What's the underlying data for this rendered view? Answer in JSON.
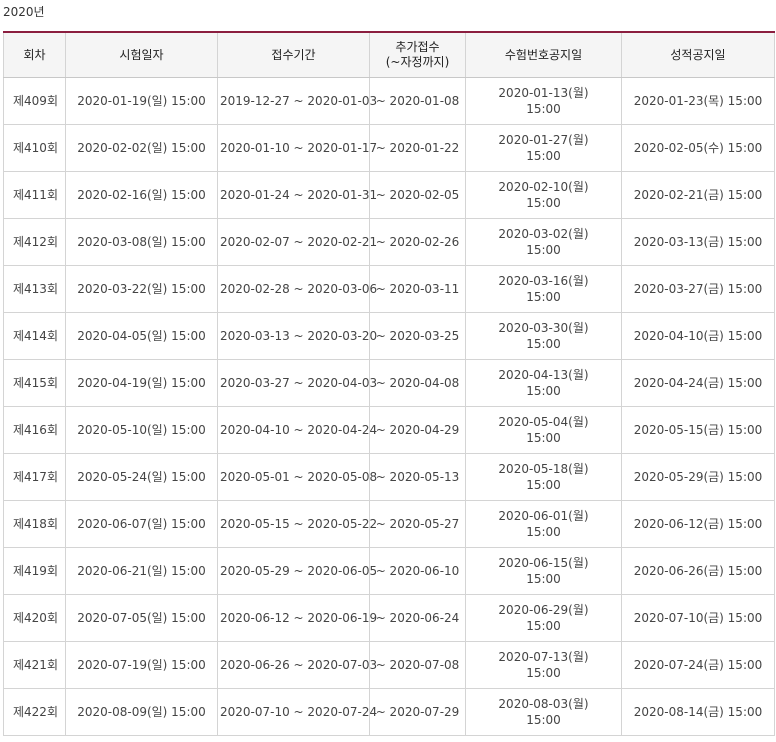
{
  "year_label": "2020년",
  "table": {
    "headers": {
      "round": "회차",
      "exam_date": "시험일자",
      "registration_period": "접수기간",
      "additional_registration_line1": "추가접수",
      "additional_registration_line2": "(~자정까지)",
      "ticket_notice": "수험번호공지일",
      "score_notice": "성적공지일"
    },
    "rows": [
      {
        "round": "제409회",
        "exam_date": "2020-01-19(일) 15:00",
        "registration_period": "2019-12-27 ~ 2020-01-03",
        "additional_registration": "~ 2020-01-08",
        "ticket_notice_date": "2020-01-13(월)",
        "ticket_notice_time": "15:00",
        "score_notice": "2020-01-23(목) 15:00"
      },
      {
        "round": "제410회",
        "exam_date": "2020-02-02(일) 15:00",
        "registration_period": "2020-01-10 ~ 2020-01-17",
        "additional_registration": "~ 2020-01-22",
        "ticket_notice_date": "2020-01-27(월)",
        "ticket_notice_time": "15:00",
        "score_notice": "2020-02-05(수) 15:00"
      },
      {
        "round": "제411회",
        "exam_date": "2020-02-16(일) 15:00",
        "registration_period": "2020-01-24 ~ 2020-01-31",
        "additional_registration": "~ 2020-02-05",
        "ticket_notice_date": "2020-02-10(월)",
        "ticket_notice_time": "15:00",
        "score_notice": "2020-02-21(금) 15:00"
      },
      {
        "round": "제412회",
        "exam_date": "2020-03-08(일) 15:00",
        "registration_period": "2020-02-07 ~ 2020-02-21",
        "additional_registration": "~ 2020-02-26",
        "ticket_notice_date": "2020-03-02(월)",
        "ticket_notice_time": "15:00",
        "score_notice": "2020-03-13(금) 15:00"
      },
      {
        "round": "제413회",
        "exam_date": "2020-03-22(일) 15:00",
        "registration_period": "2020-02-28 ~ 2020-03-06",
        "additional_registration": "~ 2020-03-11",
        "ticket_notice_date": "2020-03-16(월)",
        "ticket_notice_time": "15:00",
        "score_notice": "2020-03-27(금) 15:00"
      },
      {
        "round": "제414회",
        "exam_date": "2020-04-05(일) 15:00",
        "registration_period": "2020-03-13 ~ 2020-03-20",
        "additional_registration": "~ 2020-03-25",
        "ticket_notice_date": "2020-03-30(월)",
        "ticket_notice_time": "15:00",
        "score_notice": "2020-04-10(금) 15:00"
      },
      {
        "round": "제415회",
        "exam_date": "2020-04-19(일) 15:00",
        "registration_period": "2020-03-27 ~ 2020-04-03",
        "additional_registration": "~ 2020-04-08",
        "ticket_notice_date": "2020-04-13(월)",
        "ticket_notice_time": "15:00",
        "score_notice": "2020-04-24(금) 15:00"
      },
      {
        "round": "제416회",
        "exam_date": "2020-05-10(일) 15:00",
        "registration_period": "2020-04-10 ~ 2020-04-24",
        "additional_registration": "~ 2020-04-29",
        "ticket_notice_date": "2020-05-04(월)",
        "ticket_notice_time": "15:00",
        "score_notice": "2020-05-15(금) 15:00"
      },
      {
        "round": "제417회",
        "exam_date": "2020-05-24(일) 15:00",
        "registration_period": "2020-05-01 ~ 2020-05-08",
        "additional_registration": "~ 2020-05-13",
        "ticket_notice_date": "2020-05-18(월)",
        "ticket_notice_time": "15:00",
        "score_notice": "2020-05-29(금) 15:00"
      },
      {
        "round": "제418회",
        "exam_date": "2020-06-07(일) 15:00",
        "registration_period": "2020-05-15 ~ 2020-05-22",
        "additional_registration": "~ 2020-05-27",
        "ticket_notice_date": "2020-06-01(월)",
        "ticket_notice_time": "15:00",
        "score_notice": "2020-06-12(금) 15:00"
      },
      {
        "round": "제419회",
        "exam_date": "2020-06-21(일) 15:00",
        "registration_period": "2020-05-29 ~ 2020-06-05",
        "additional_registration": "~ 2020-06-10",
        "ticket_notice_date": "2020-06-15(월)",
        "ticket_notice_time": "15:00",
        "score_notice": "2020-06-26(금) 15:00"
      },
      {
        "round": "제420회",
        "exam_date": "2020-07-05(일) 15:00",
        "registration_period": "2020-06-12 ~ 2020-06-19",
        "additional_registration": "~ 2020-06-24",
        "ticket_notice_date": "2020-06-29(월)",
        "ticket_notice_time": "15:00",
        "score_notice": "2020-07-10(금) 15:00"
      },
      {
        "round": "제421회",
        "exam_date": "2020-07-19(일) 15:00",
        "registration_period": "2020-06-26 ~ 2020-07-03",
        "additional_registration": "~ 2020-07-08",
        "ticket_notice_date": "2020-07-13(월)",
        "ticket_notice_time": "15:00",
        "score_notice": "2020-07-24(금) 15:00"
      },
      {
        "round": "제422회",
        "exam_date": "2020-08-09(일) 15:00",
        "registration_period": "2020-07-10 ~ 2020-07-24",
        "additional_registration": "~ 2020-07-29",
        "ticket_notice_date": "2020-08-03(월)",
        "ticket_notice_time": "15:00",
        "score_notice": "2020-08-14(금) 15:00"
      }
    ]
  },
  "colors": {
    "header_top_border": "#8b1e3f",
    "header_background": "#f5f5f5",
    "grid_line": "#d4d4d4"
  }
}
